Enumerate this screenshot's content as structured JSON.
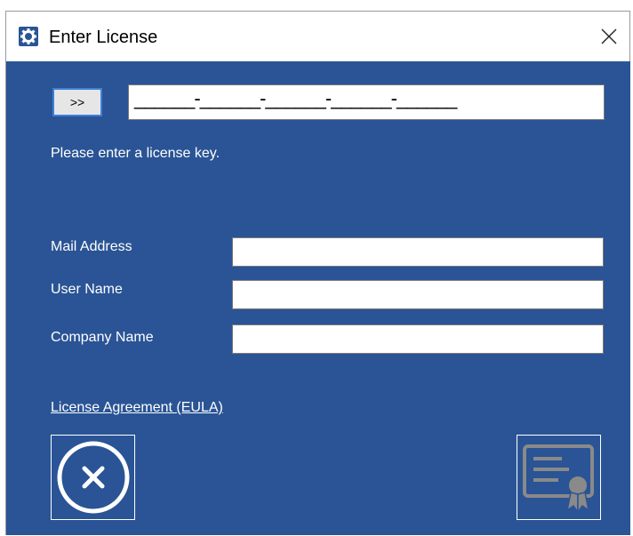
{
  "window": {
    "title": "Enter License",
    "app_icon": "gear-icon",
    "close_icon": "close-icon"
  },
  "license": {
    "go_label": ">>",
    "key_mask": "______-______-______-______-______",
    "prompt": "Please enter a license key."
  },
  "form": {
    "mail_label": "Mail Address",
    "mail_value": "",
    "user_label": "User Name",
    "user_value": "",
    "company_label": "Company Name",
    "company_value": ""
  },
  "footer": {
    "eula_link": "License Agreement (EULA)",
    "cancel_icon": "cancel-circle-icon",
    "certificate_icon": "certificate-icon"
  },
  "colors": {
    "panel_blue": "#2a5495",
    "button_focus_border": "#3e80d8"
  }
}
